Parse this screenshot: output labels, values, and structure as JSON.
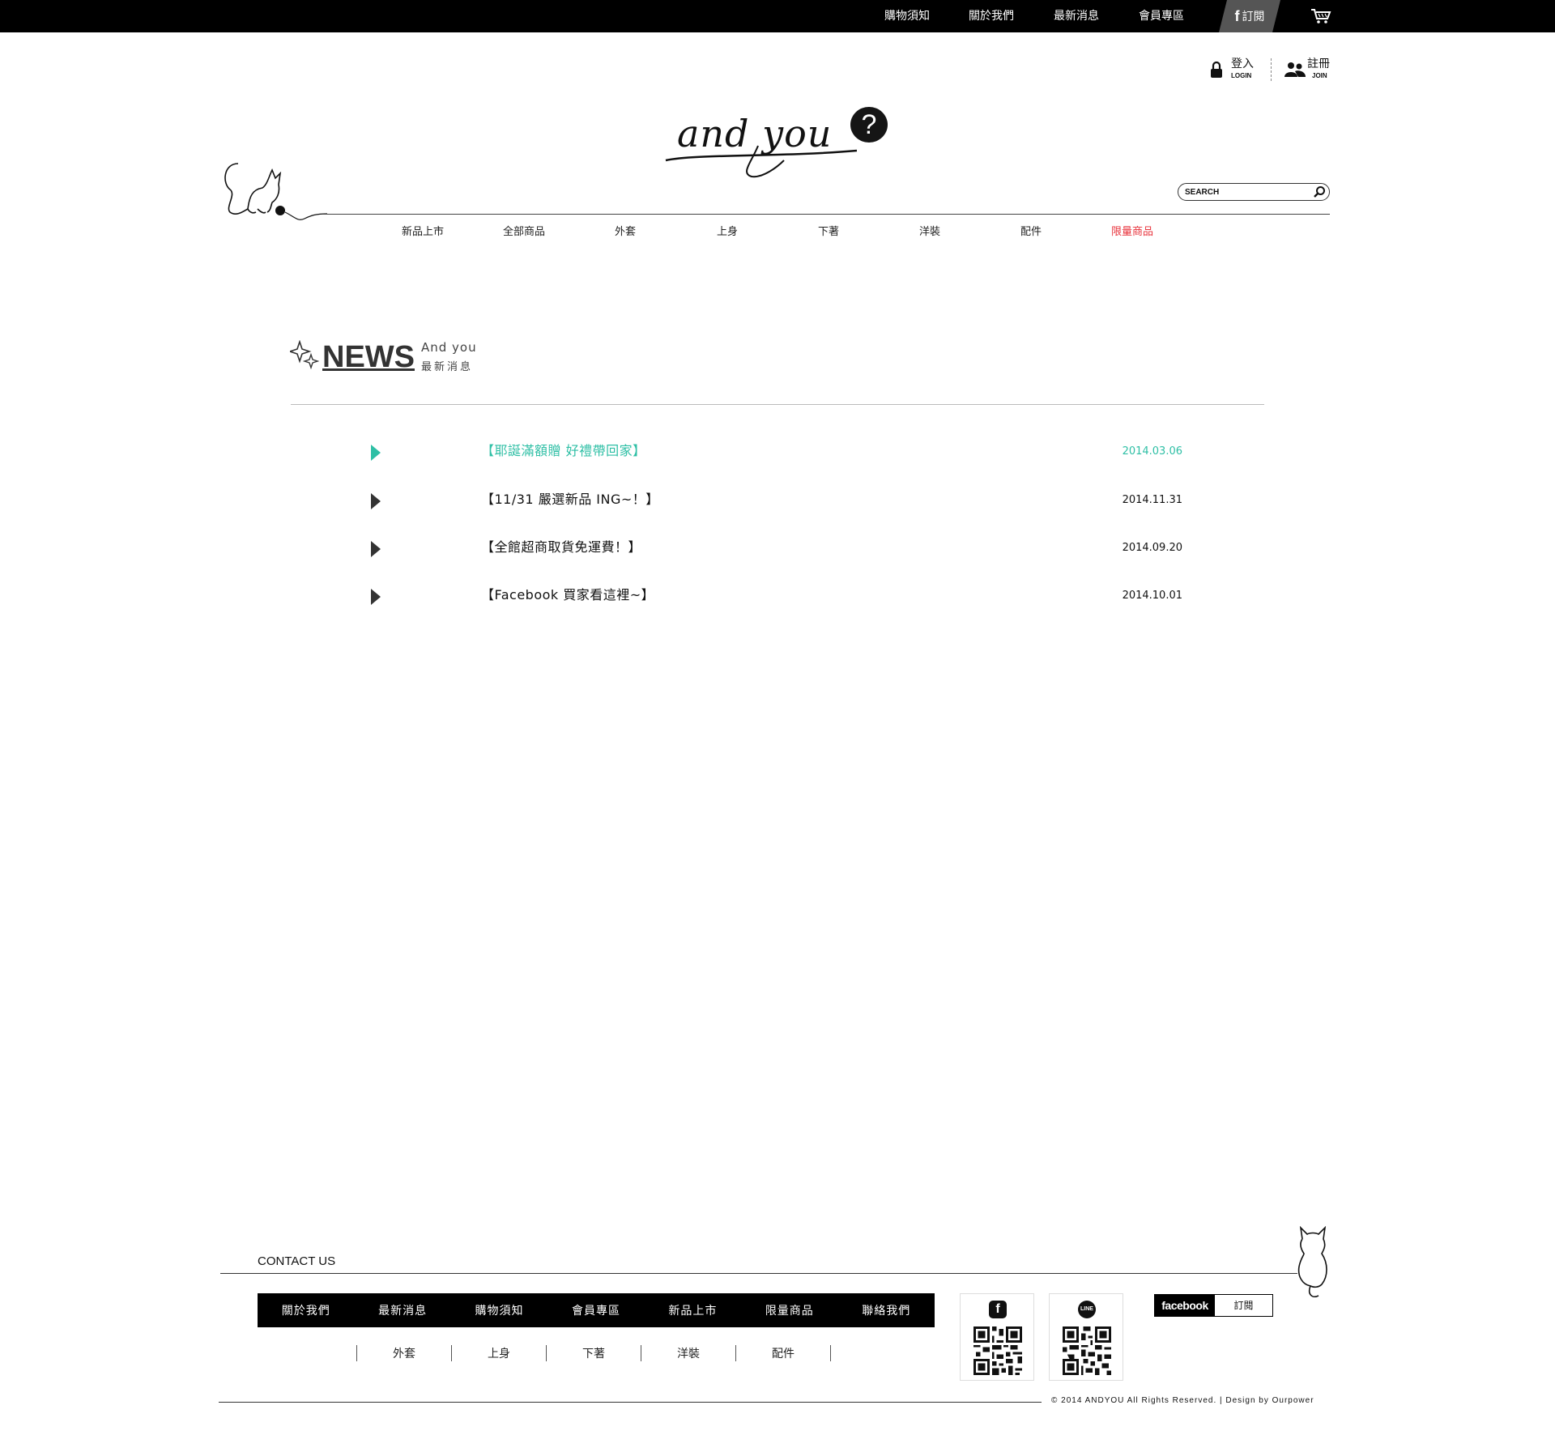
{
  "topbar": {
    "items": [
      "購物須知",
      "關於我們",
      "最新消息",
      "會員專區"
    ],
    "fb_subscribe": "訂閱",
    "cart_icon": "cart-icon"
  },
  "account": {
    "login_label": "登入",
    "login_sub": "LOGIN",
    "join_label": "註冊",
    "join_sub": "JOIN"
  },
  "logo": {
    "text": "and you",
    "mark": "?"
  },
  "search": {
    "placeholder": "SEARCH"
  },
  "main_nav": [
    "新品上市",
    "全部商品",
    "外套",
    "上身",
    "下著",
    "洋裝",
    "配件",
    "限量商品"
  ],
  "news": {
    "title": "NEWS",
    "subtitle_en": "And you",
    "subtitle_zh": "最新消息",
    "items": [
      {
        "title": "【耶誕滿額贈 好禮帶回家】",
        "date": "2014.03.06"
      },
      {
        "title": "【11/31 嚴選新品 ING~！】",
        "date": "2014.11.31"
      },
      {
        "title": "【全館超商取貨免運費！】",
        "date": "2014.09.20"
      },
      {
        "title": "【Facebook 買家看這裡~】",
        "date": "2014.10.01"
      }
    ]
  },
  "footer": {
    "contact": "CONTACT US",
    "nav": [
      "關於我們",
      "最新消息",
      "購物須知",
      "會員專區",
      "新品上市",
      "限量商品",
      "聯絡我們"
    ],
    "subnav": [
      "外套",
      "上身",
      "下著",
      "洋裝",
      "配件"
    ],
    "qr": [
      {
        "badge": "f"
      },
      {
        "badge": "LINE"
      }
    ],
    "fb_brand": "facebook",
    "fb_subscribe": "訂閱",
    "copyright": "© 2014 ANDYOU All Rights Reserved. | Design by Ourpower"
  },
  "colors": {
    "accent": "#2ebfa5",
    "limited": "#e8333c",
    "topbar": "#000000"
  }
}
